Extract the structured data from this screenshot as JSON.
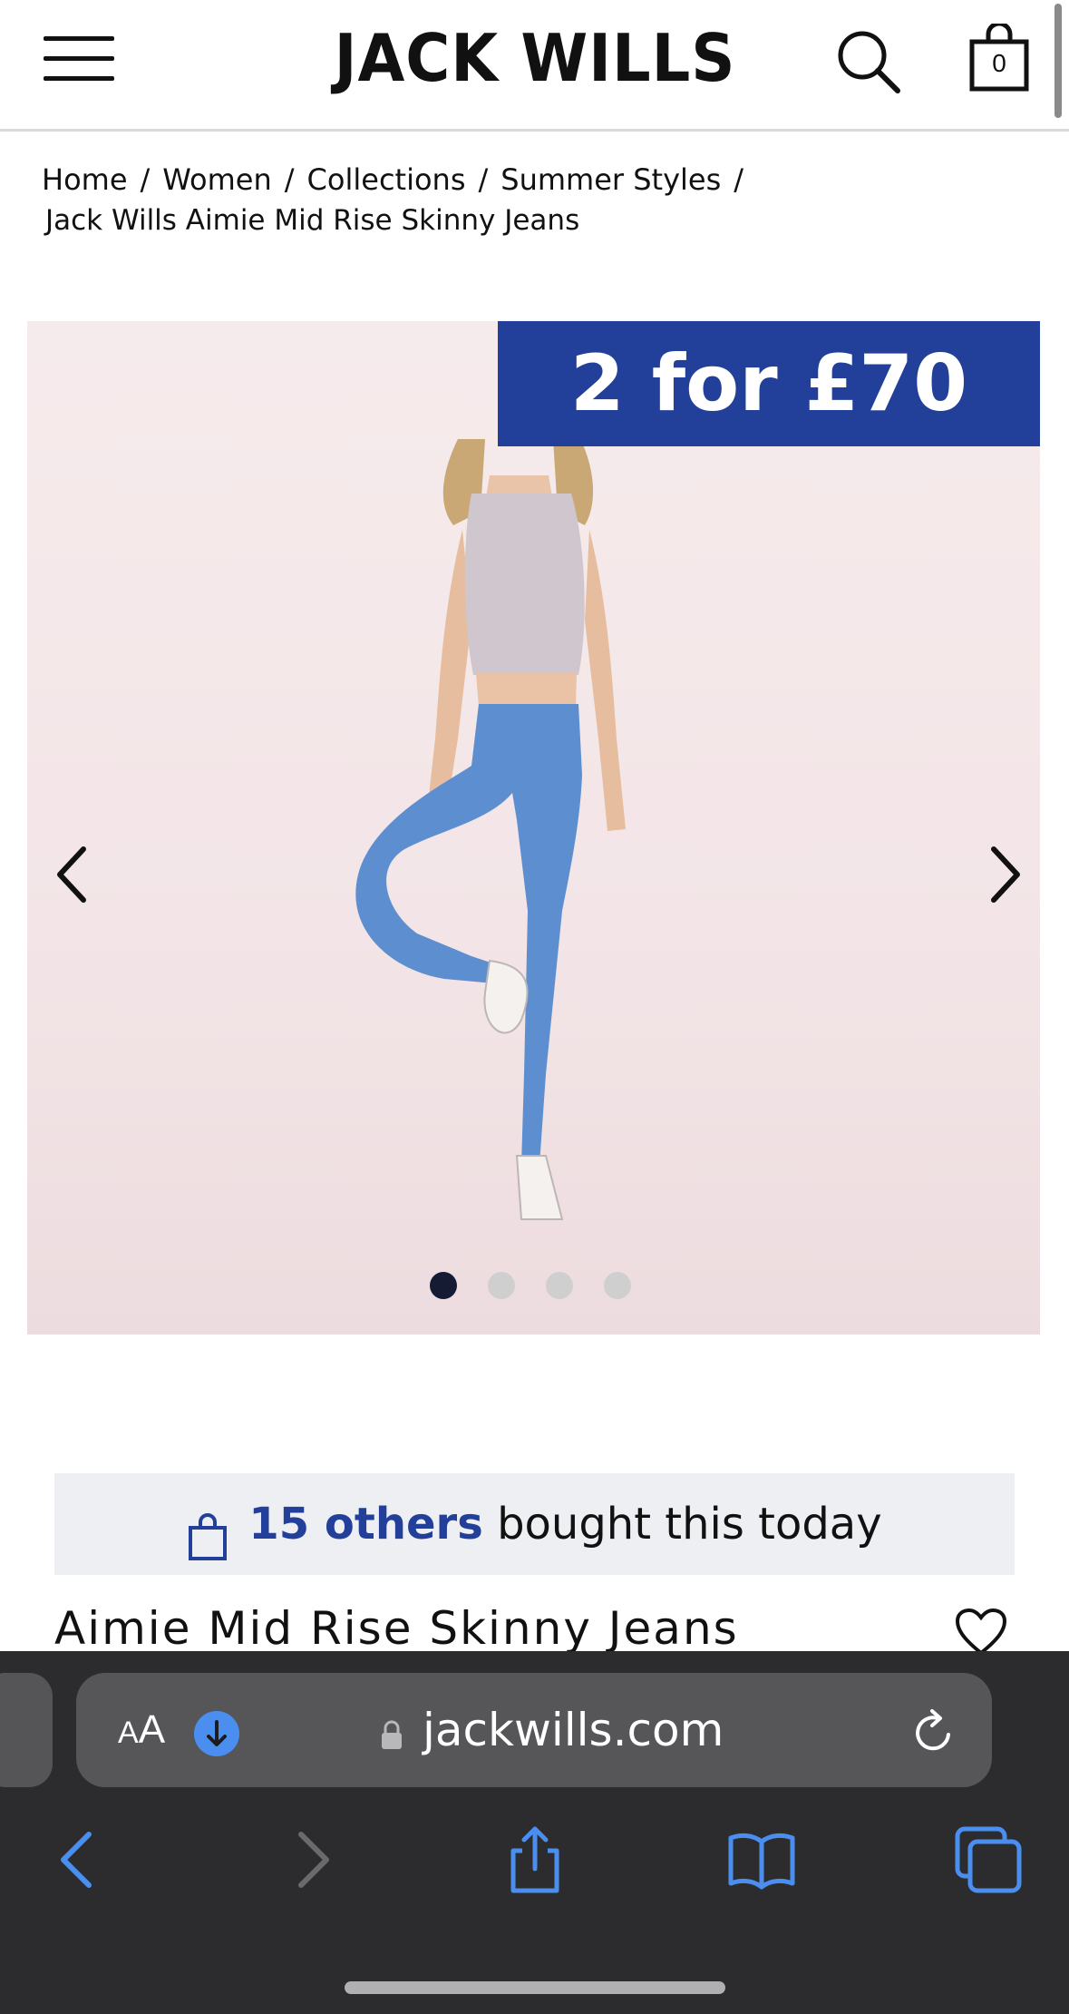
{
  "header": {
    "logo": "JACK WILLS",
    "bag_count": "0"
  },
  "breadcrumb": {
    "items": [
      "Home",
      "Women",
      "Collections",
      "Summer Styles"
    ],
    "separator": "/",
    "current": "Jack Wills Aimie Mid Rise Skinny Jeans"
  },
  "gallery": {
    "promo": "2 for £70",
    "slide_count": 4,
    "active_slide": 1
  },
  "social_proof": {
    "count": "15 others",
    "text": "bought this today"
  },
  "product": {
    "title": "Aimie Mid Rise Skinny Jeans"
  },
  "browser": {
    "text_size_small": "A",
    "text_size_large": "A",
    "url": "jackwills.com"
  },
  "colors": {
    "brand_blue": "#223f99",
    "safari_accent": "#4a8ff0"
  }
}
